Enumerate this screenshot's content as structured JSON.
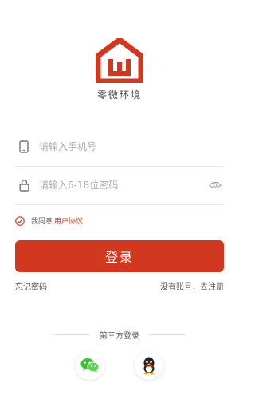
{
  "app": {
    "name": "零微环境",
    "logo_icon": "house-w-logo-icon",
    "accent_color": "#d2381f"
  },
  "form": {
    "phone": {
      "icon": "phone-icon",
      "placeholder": "请输入手机号",
      "value": ""
    },
    "password": {
      "icon": "lock-icon",
      "placeholder": "请输入6-18位密码",
      "value": "",
      "toggle_icon": "eye-icon"
    },
    "agreement": {
      "checked": true,
      "prefix": "我同意",
      "link": "用户协议"
    },
    "login_label": "登录"
  },
  "links": {
    "forgot": "忘记密码",
    "register": "没有账号，去注册"
  },
  "third_party": {
    "title": "第三方登录",
    "providers": [
      {
        "name": "wechat",
        "icon": "wechat-icon"
      },
      {
        "name": "qq",
        "icon": "qq-icon"
      }
    ]
  }
}
